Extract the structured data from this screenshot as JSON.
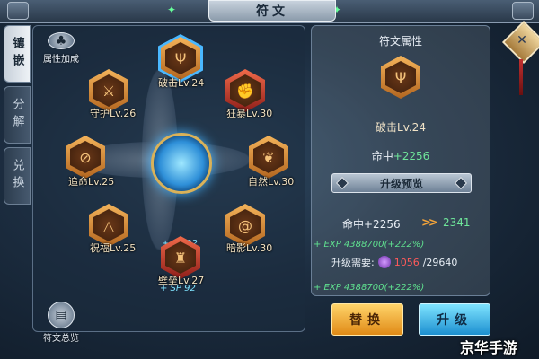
{
  "window": {
    "title": "符文"
  },
  "tabs": [
    {
      "label": "镶嵌",
      "active": true
    },
    {
      "label": "分解",
      "active": false
    },
    {
      "label": "兑换",
      "active": false
    }
  ],
  "left_panel": {
    "attr_bonus_label": "属性加成",
    "overview_label": "符文总览",
    "runes": [
      {
        "id": "pojí",
        "label": "破击Lv.24",
        "icon": "trident-icon",
        "color": "orange",
        "selected": true
      },
      {
        "id": "kuangbao",
        "label": "狂暴Lv.30",
        "icon": "fist-icon",
        "color": "red"
      },
      {
        "id": "shouhu",
        "label": "守护Lv.26",
        "icon": "shield-axe-icon",
        "color": "orange"
      },
      {
        "id": "ziran",
        "label": "自然Lv.30",
        "icon": "leaf-icon",
        "color": "orange"
      },
      {
        "id": "zhuiming",
        "label": "追命Lv.25",
        "icon": "crossed-circle-icon",
        "color": "orange"
      },
      {
        "id": "zhufu",
        "label": "祝福Lv.25",
        "icon": "eye-triangle-icon",
        "color": "orange"
      },
      {
        "id": "anying",
        "label": "暗影Lv.30",
        "icon": "swirl-icon",
        "color": "orange"
      },
      {
        "id": "bilei",
        "label": "壁垒Lv.27",
        "icon": "helmet-icon",
        "color": "red"
      }
    ],
    "sp_top": "+ SP 92",
    "sp_bottom": "+ SP 92"
  },
  "right_panel": {
    "title": "符文属性",
    "rune_name": "破击Lv.24",
    "stat_label": "命中",
    "stat_value": "+2256",
    "preview_label": "升级预览",
    "upgrade_current": "命中+2256",
    "upgrade_arrow": ">>",
    "upgrade_next": "2341",
    "exp_line_1": "+ EXP 4388700(+222%)",
    "need_label": "升级需要:",
    "need_have": "1056",
    "need_total": "/29640",
    "exp_line_2": "+ EXP 4388700(+222%)"
  },
  "buttons": {
    "replace": "替换",
    "upgrade": "升级"
  },
  "watermark": "京华手游",
  "colors": {
    "accent_orange": "#f0a030",
    "accent_blue": "#2e9be0",
    "exp_green": "#5fe08f",
    "need_red": "#ff5a5a"
  }
}
